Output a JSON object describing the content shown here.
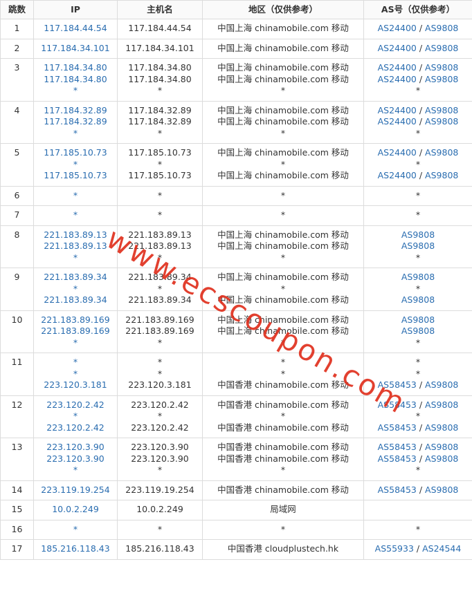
{
  "headers": {
    "hop": "跳数",
    "ip": "IP",
    "host": "主机名",
    "region": "地区（仅供参考）",
    "as": "AS号（仅供参考）"
  },
  "watermark": "www.ecscoupon.com",
  "rows": [
    {
      "hop": "1",
      "ip": [
        "117.184.44.54"
      ],
      "host": [
        "117.184.44.54"
      ],
      "region": [
        "中国上海 chinamobile.com 移动"
      ],
      "as": [
        [
          "AS24400",
          "AS9808"
        ]
      ]
    },
    {
      "hop": "2",
      "ip": [
        "117.184.34.101"
      ],
      "host": [
        "117.184.34.101"
      ],
      "region": [
        "中国上海 chinamobile.com 移动"
      ],
      "as": [
        [
          "AS24400",
          "AS9808"
        ]
      ]
    },
    {
      "hop": "3",
      "ip": [
        "117.184.34.80",
        "117.184.34.80",
        "*"
      ],
      "host": [
        "117.184.34.80",
        "117.184.34.80",
        "*"
      ],
      "region": [
        "中国上海 chinamobile.com 移动",
        "中国上海 chinamobile.com 移动",
        "*"
      ],
      "as": [
        [
          "AS24400",
          "AS9808"
        ],
        [
          "AS24400",
          "AS9808"
        ],
        [
          "*"
        ]
      ]
    },
    {
      "hop": "4",
      "ip": [
        "117.184.32.89",
        "117.184.32.89",
        "*"
      ],
      "host": [
        "117.184.32.89",
        "117.184.32.89",
        "*"
      ],
      "region": [
        "中国上海 chinamobile.com 移动",
        "中国上海 chinamobile.com 移动",
        "*"
      ],
      "as": [
        [
          "AS24400",
          "AS9808"
        ],
        [
          "AS24400",
          "AS9808"
        ],
        [
          "*"
        ]
      ]
    },
    {
      "hop": "5",
      "ip": [
        "117.185.10.73",
        "*",
        "117.185.10.73"
      ],
      "host": [
        "117.185.10.73",
        "*",
        "117.185.10.73"
      ],
      "region": [
        "中国上海 chinamobile.com 移动",
        "*",
        "中国上海 chinamobile.com 移动"
      ],
      "as": [
        [
          "AS24400",
          "AS9808"
        ],
        [
          "*"
        ],
        [
          "AS24400",
          "AS9808"
        ]
      ]
    },
    {
      "hop": "6",
      "ip": [
        "*"
      ],
      "host": [
        "*"
      ],
      "region": [
        "*"
      ],
      "as": [
        [
          "*"
        ]
      ]
    },
    {
      "hop": "7",
      "ip": [
        "*"
      ],
      "host": [
        "*"
      ],
      "region": [
        "*"
      ],
      "as": [
        [
          "*"
        ]
      ]
    },
    {
      "hop": "8",
      "ip": [
        "221.183.89.13",
        "221.183.89.13",
        "*"
      ],
      "host": [
        "221.183.89.13",
        "221.183.89.13",
        "*"
      ],
      "region": [
        "中国上海 chinamobile.com 移动",
        "中国上海 chinamobile.com 移动",
        "*"
      ],
      "as": [
        [
          "AS9808"
        ],
        [
          "AS9808"
        ],
        [
          "*"
        ]
      ]
    },
    {
      "hop": "9",
      "ip": [
        "221.183.89.34",
        "*",
        "221.183.89.34"
      ],
      "host": [
        "221.183.89.34",
        "*",
        "221.183.89.34"
      ],
      "region": [
        "中国上海 chinamobile.com 移动",
        "*",
        "中国上海 chinamobile.com 移动"
      ],
      "as": [
        [
          "AS9808"
        ],
        [
          "*"
        ],
        [
          "AS9808"
        ]
      ]
    },
    {
      "hop": "10",
      "ip": [
        "221.183.89.169",
        "221.183.89.169",
        "*"
      ],
      "host": [
        "221.183.89.169",
        "221.183.89.169",
        "*"
      ],
      "region": [
        "中国上海 chinamobile.com 移动",
        "中国上海 chinamobile.com 移动",
        "*"
      ],
      "as": [
        [
          "AS9808"
        ],
        [
          "AS9808"
        ],
        [
          "*"
        ]
      ]
    },
    {
      "hop": "11",
      "ip": [
        "*",
        "*",
        "223.120.3.181"
      ],
      "host": [
        "*",
        "*",
        "223.120.3.181"
      ],
      "region": [
        "*",
        "*",
        "中国香港 chinamobile.com 移动"
      ],
      "as": [
        [
          "*"
        ],
        [
          "*"
        ],
        [
          "AS58453",
          "AS9808"
        ]
      ]
    },
    {
      "hop": "12",
      "ip": [
        "223.120.2.42",
        "*",
        "223.120.2.42"
      ],
      "host": [
        "223.120.2.42",
        "*",
        "223.120.2.42"
      ],
      "region": [
        "中国香港 chinamobile.com 移动",
        "*",
        "中国香港 chinamobile.com 移动"
      ],
      "as": [
        [
          "AS58453",
          "AS9808"
        ],
        [
          "*"
        ],
        [
          "AS58453",
          "AS9808"
        ]
      ]
    },
    {
      "hop": "13",
      "ip": [
        "223.120.3.90",
        "223.120.3.90",
        "*"
      ],
      "host": [
        "223.120.3.90",
        "223.120.3.90",
        "*"
      ],
      "region": [
        "中国香港 chinamobile.com 移动",
        "中国香港 chinamobile.com 移动",
        "*"
      ],
      "as": [
        [
          "AS58453",
          "AS9808"
        ],
        [
          "AS58453",
          "AS9808"
        ],
        [
          "*"
        ]
      ]
    },
    {
      "hop": "14",
      "ip": [
        "223.119.19.254"
      ],
      "host": [
        "223.119.19.254"
      ],
      "region": [
        "中国香港 chinamobile.com 移动"
      ],
      "as": [
        [
          "AS58453",
          "AS9808"
        ]
      ]
    },
    {
      "hop": "15",
      "ip": [
        "10.0.2.249"
      ],
      "host": [
        "10.0.2.249"
      ],
      "region": [
        "局域网"
      ],
      "as": [
        []
      ]
    },
    {
      "hop": "16",
      "ip": [
        "*"
      ],
      "host": [
        "*"
      ],
      "region": [
        "*"
      ],
      "as": [
        [
          "*"
        ]
      ]
    },
    {
      "hop": "17",
      "ip": [
        "185.216.118.43"
      ],
      "host": [
        "185.216.118.43"
      ],
      "region": [
        "中国香港 cloudplustech.hk"
      ],
      "as": [
        [
          "AS55933",
          "AS24544"
        ]
      ]
    }
  ]
}
